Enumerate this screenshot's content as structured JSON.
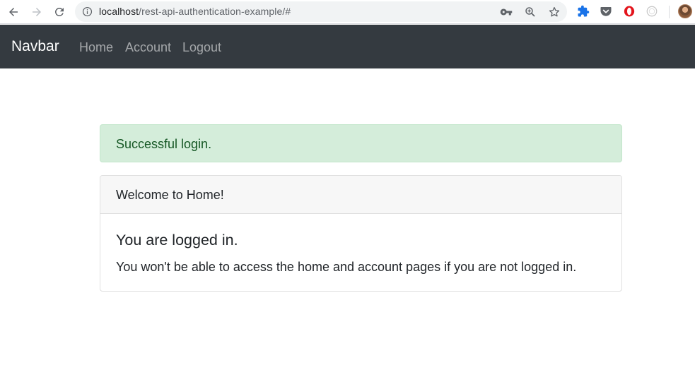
{
  "browser": {
    "url_host": "localhost",
    "url_path": "/rest-api-authentication-example/#",
    "icons": [
      "back-arrow-icon",
      "forward-arrow-icon",
      "reload-icon",
      "info-icon",
      "key-icon",
      "zoom-icon",
      "star-icon",
      "puzzle-extension-icon",
      "pocket-icon",
      "opera-icon",
      "extension-circle-icon",
      "profile-avatar"
    ]
  },
  "navbar": {
    "brand": "Navbar",
    "links": [
      "Home",
      "Account",
      "Logout"
    ],
    "background": "#343a40"
  },
  "alert": {
    "text": "Successful login.",
    "color": "#155724",
    "background": "#d4edda"
  },
  "card": {
    "header": "Welcome to Home!",
    "title": "You are logged in.",
    "text": "You won't be able to access the home and account pages if you are not logged in."
  }
}
